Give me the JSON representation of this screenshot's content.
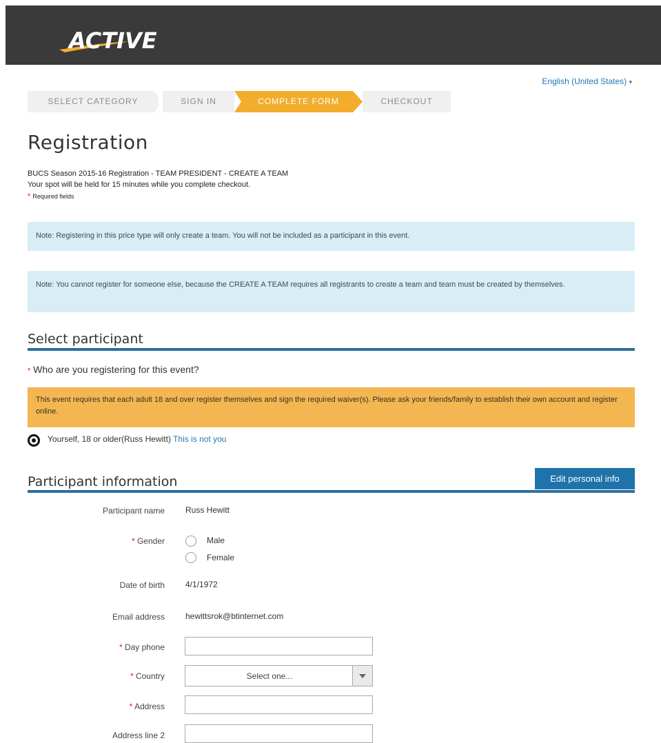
{
  "header": {
    "logo_text": "ACTIVE"
  },
  "language": {
    "label": "English (United States)",
    "caret": "▾"
  },
  "steps": [
    {
      "label": "SELECT CATEGORY",
      "active": false
    },
    {
      "label": "SIGN IN",
      "active": false
    },
    {
      "label": "COMPLETE FORM",
      "active": true
    },
    {
      "label": "CHECKOUT",
      "active": false
    }
  ],
  "colors": {
    "accent": "#f2ad2d",
    "header": "#3a3a3a",
    "rule": "#2b6f9b",
    "button": "#1e73ab",
    "note": "#d9edf5",
    "warning": "#f3b650"
  },
  "page": {
    "title": "Registration",
    "event_line": "BUCS Season 2015-16 Registration - TEAM PRESIDENT - CREATE A TEAM",
    "hold_line": "Your spot will be held for 15 minutes while you complete checkout.",
    "required_marker": "*",
    "required_text": "Required fields"
  },
  "notes": {
    "note1": "Note: Registering in this price type will only create a team. You will not be included as a participant in this event.",
    "note2": "Note: You cannot register for someone else, because the CREATE A TEAM requires all registrants to create a team and team must be created by themselves."
  },
  "select_participant": {
    "title": "Select participant",
    "question": "Who are you registering for this event?",
    "warning": "This event requires that each adult 18 and over register themselves and sign the required waiver(s). Please ask your friends/family to establish their own account and register online.",
    "option_label": "Yourself, 18 or older(Russ Hewitt)",
    "not_you_link": "This is not you"
  },
  "participant_info": {
    "title": "Participant information",
    "edit_button": "Edit personal info",
    "fields": {
      "name_label": "Participant name",
      "name_value": "Russ Hewitt",
      "gender_label": "Gender",
      "gender_male": "Male",
      "gender_female": "Female",
      "dob_label": "Date of birth",
      "dob_value": "4/1/1972",
      "email_label": "Email address",
      "email_value": "hewittsrok@btinternet.com",
      "phone_label": "Day phone",
      "country_label": "Country",
      "country_placeholder": "Select one...",
      "address_label": "Address",
      "address2_label": "Address line 2"
    }
  }
}
